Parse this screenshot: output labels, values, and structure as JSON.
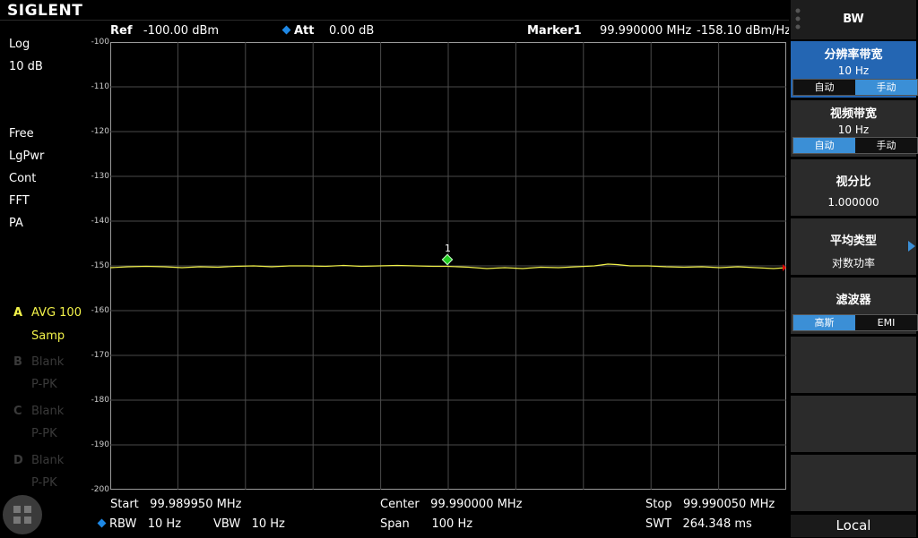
{
  "brand": "SIGLENT",
  "header": {
    "ref_label": "Ref",
    "ref_value": "-100.00 dBm",
    "att_label": "Att",
    "att_value": "0.00 dB",
    "marker_label": "Marker1",
    "marker_freq": "99.990000 MHz",
    "marker_level": "-158.10 dBm/Hz"
  },
  "left_panel": {
    "scale_type": "Log",
    "scale_div": "10 dB",
    "trigger": "Free",
    "detector": "LgPwr",
    "sweep": "Cont",
    "mode": "FFT",
    "preamp": "PA",
    "traces": [
      {
        "letter": "A",
        "state": "AVG 100",
        "detector": "Samp",
        "active": true
      },
      {
        "letter": "B",
        "state": "Blank",
        "detector": "P-PK",
        "active": false
      },
      {
        "letter": "C",
        "state": "Blank",
        "detector": "P-PK",
        "active": false
      },
      {
        "letter": "D",
        "state": "Blank",
        "detector": "P-PK",
        "active": false
      }
    ]
  },
  "y_axis": [
    "-100",
    "-110",
    "-120",
    "-130",
    "-140",
    "-150",
    "-160",
    "-170",
    "-180",
    "-190",
    "-200"
  ],
  "marker_number": "1",
  "footer": {
    "start_label": "Start",
    "start_value": "99.989950 MHz",
    "center_label": "Center",
    "center_value": "99.990000 MHz",
    "stop_label": "Stop",
    "stop_value": "99.990050 MHz",
    "rbw_label": "RBW",
    "rbw_value": "10 Hz",
    "vbw_label": "VBW",
    "vbw_value": "10 Hz",
    "span_label": "Span",
    "span_value": "100 Hz",
    "swt_label": "SWT",
    "swt_value": "264.348 ms"
  },
  "menu": {
    "title": "BW",
    "rbw": {
      "title": "分辨率带宽",
      "value": "10 Hz",
      "opt_auto": "自动",
      "opt_manual": "手动"
    },
    "vbw": {
      "title": "视频带宽",
      "value": "10 Hz",
      "opt_auto": "自动",
      "opt_manual": "手动"
    },
    "ratio": {
      "title": "视分比",
      "value": "1.000000"
    },
    "avg_type": {
      "title": "平均类型",
      "value": "对数功率"
    },
    "filter": {
      "title": "滤波器",
      "opt_gauss": "高斯",
      "opt_emi": "EMI"
    },
    "local": "Local"
  },
  "colors": {
    "trace": "#f2f24a",
    "marker": "#22cc22",
    "accent": "#3b8fd6"
  }
}
